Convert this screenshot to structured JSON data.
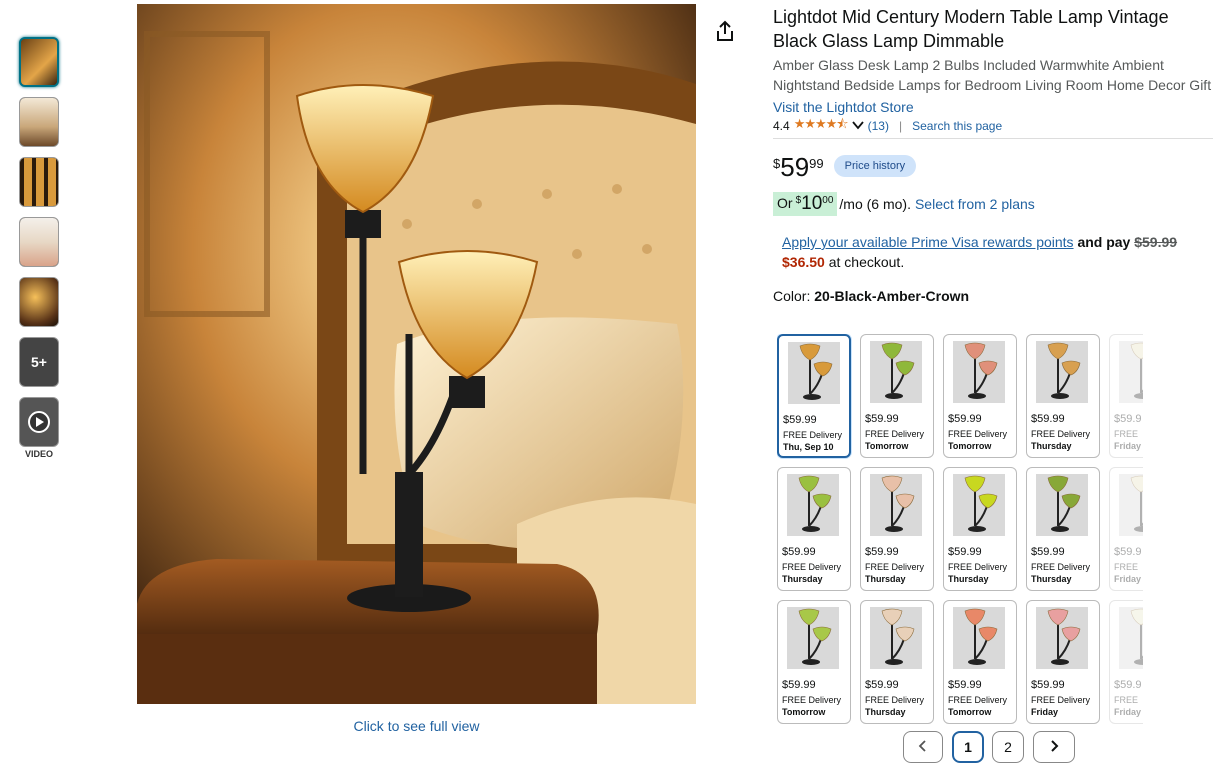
{
  "thumbnails": [
    {
      "kind": "image"
    },
    {
      "kind": "image"
    },
    {
      "kind": "image"
    },
    {
      "kind": "image"
    },
    {
      "kind": "image"
    },
    {
      "kind": "more",
      "label": "5+"
    },
    {
      "kind": "video",
      "label": "VIDEO"
    }
  ],
  "main_image": {
    "click_text": "Click to see full view"
  },
  "product": {
    "title": "Lightdot Mid Century Modern Table Lamp Vintage Black Glass Lamp Dimmable",
    "subtitle": "Amber Glass Desk Lamp 2 Bulbs Included Warmwhite Ambient Nightstand Bedside Lamps for Bedroom Living Room Home Decor Gift",
    "store_link": "Visit the Lightdot Store",
    "rating": "4.4",
    "stars": "★★★★⯪",
    "review_count": "(13)",
    "search_page": "Search this page"
  },
  "price": {
    "symbol": "$",
    "whole": "59",
    "fraction": "99",
    "history_label": "Price history"
  },
  "monthly": {
    "or": "Or",
    "symbol": "$",
    "whole": "10",
    "fraction": "00",
    "rest": "/mo (6 mo).",
    "plans_link": "Select from 2 plans"
  },
  "prime": {
    "link": "Apply your available Prime Visa rewards points",
    "and_pay": "and pay",
    "old": "$59.99",
    "new": "$36.50",
    "tail": "at checkout."
  },
  "color": {
    "label": "Color:",
    "value": "20-Black-Amber-Crown"
  },
  "swatches": [
    {
      "price": "$59.99",
      "delivery": "FREE Delivery",
      "date": "Thu, Sep 10",
      "glass": "#d89a3a",
      "selected": true
    },
    {
      "price": "$59.99",
      "delivery": "FREE Delivery",
      "date": "Tomorrow",
      "glass": "#8fb83a"
    },
    {
      "price": "$59.99",
      "delivery": "FREE Delivery",
      "date": "Tomorrow",
      "glass": "#e0907a"
    },
    {
      "price": "$59.99",
      "delivery": "FREE Delivery",
      "date": "Thursday",
      "glass": "#d8a050"
    },
    {
      "price": "$59.9",
      "delivery": "FREE",
      "date": "Friday",
      "glass": "#e8e0c0",
      "faded": true
    },
    {
      "price": "$59.99",
      "delivery": "FREE Delivery",
      "date": "Thursday",
      "glass": "#9ac040"
    },
    {
      "price": "$59.99",
      "delivery": "FREE Delivery",
      "date": "Thursday",
      "glass": "#e8c0a8"
    },
    {
      "price": "$59.99",
      "delivery": "FREE Delivery",
      "date": "Thursday",
      "glass": "#c8d820"
    },
    {
      "price": "$59.99",
      "delivery": "FREE Delivery",
      "date": "Thursday",
      "glass": "#88a838"
    },
    {
      "price": "$59.9",
      "delivery": "FREE",
      "date": "Friday",
      "glass": "#e8e0c0",
      "faded": true
    },
    {
      "price": "$59.99",
      "delivery": "FREE Delivery",
      "date": "Tomorrow",
      "glass": "#a8c848"
    },
    {
      "price": "$59.99",
      "delivery": "FREE Delivery",
      "date": "Thursday",
      "glass": "#e8d0b8"
    },
    {
      "price": "$59.99",
      "delivery": "FREE Delivery",
      "date": "Tomorrow",
      "glass": "#e88868"
    },
    {
      "price": "$59.99",
      "delivery": "FREE Delivery",
      "date": "Friday",
      "glass": "#e8a0a0"
    },
    {
      "price": "$59.9",
      "delivery": "FREE",
      "date": "Friday",
      "glass": "#e8e8c8",
      "faded": true
    }
  ],
  "pagination": {
    "pages": [
      "1",
      "2"
    ],
    "current": "1"
  },
  "colors": {
    "link": "#2162a1",
    "accent_red": "#b12704",
    "star": "#de7921"
  }
}
